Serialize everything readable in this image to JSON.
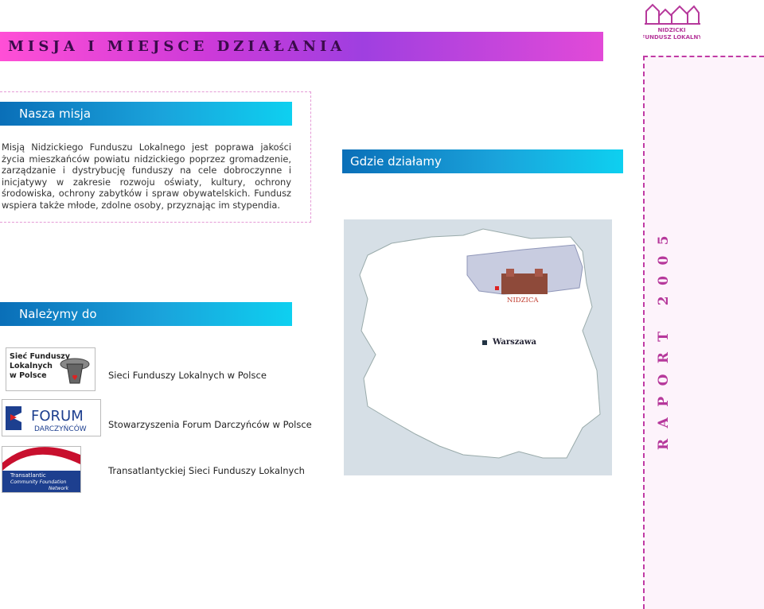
{
  "title": "MISJA I MIEJSCE DZIAŁANIA",
  "logo_top": {
    "line1": "NIDZICKI",
    "line2": "FUNDUSZ LOKALNY"
  },
  "mission": {
    "header": "Nasza misja",
    "text": "Misją Nidzickiego Funduszu Lokalnego jest poprawa jakości życia mieszkańców powiatu nidzickiego poprzez gromadzenie, zarządzanie i dystrybucję funduszy na cele dobroczynne i inicjatywy w zakresie rozwoju oświaty, kultury, ochrony środowiska, ochrony zabytków i spraw obywatelskich. Fundusz wspiera także młode, zdolne osoby, przyznając im stypendia."
  },
  "where": {
    "header": "Gdzie działamy",
    "map_labels": {
      "nidzica": "NIDZICA",
      "warszawa": "Warszawa"
    }
  },
  "members": {
    "header": "Należymy do",
    "orgs": [
      {
        "name": "Sieci Funduszy Lokalnych w Polsce",
        "logo_text": [
          "Sieć Funduszy",
          "Lokalnych",
          "w Polsce"
        ]
      },
      {
        "name": "Stowarzyszenia Forum Darczyńców w Polsce",
        "logo_text": [
          "FORUM",
          "DARCZYŃCÓW"
        ]
      },
      {
        "name": "Transatlantyckiej Sieci Funduszy Lokalnych",
        "logo_text": [
          "Transatlantic",
          "Community Foundation",
          "Network"
        ]
      }
    ]
  },
  "side": {
    "raport": "RAPORT 2005"
  },
  "colors": {
    "title_gradient": "#cc3ad9",
    "section_blue": "#1aa3db",
    "accent_purple": "#b6389b"
  }
}
